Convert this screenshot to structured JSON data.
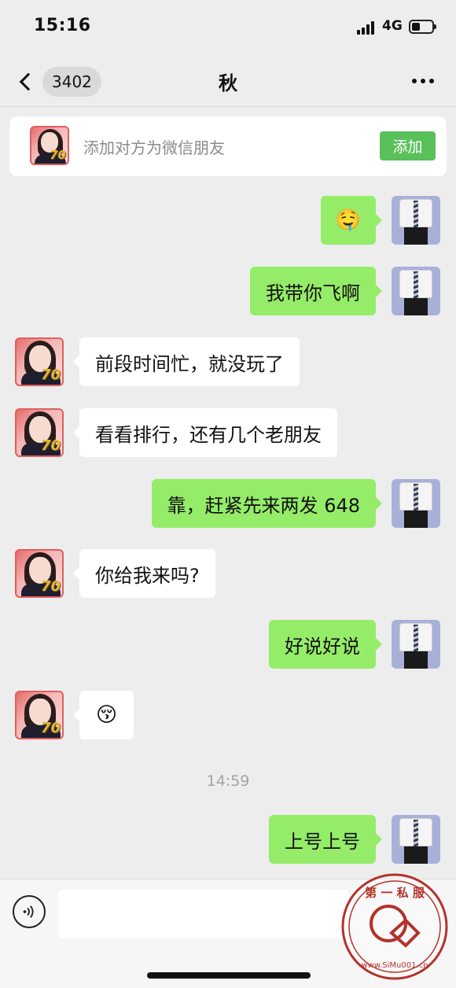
{
  "status_bar": {
    "time": "15:16",
    "network": "4G"
  },
  "nav": {
    "unread_count": "3402",
    "title": "秋"
  },
  "add_friend": {
    "prompt": "添加对方为微信朋友",
    "button_label": "添加"
  },
  "avatar_badge": "70",
  "messages": [
    {
      "side": "out",
      "text": "🤤"
    },
    {
      "side": "out",
      "text": "我带你飞啊"
    },
    {
      "side": "in",
      "text": "前段时间忙，就没玩了"
    },
    {
      "side": "in",
      "text": "看看排行，还有几个老朋友"
    },
    {
      "side": "out",
      "text": "靠，赶紧先来两发 648"
    },
    {
      "side": "in",
      "text": "你给我来吗?"
    },
    {
      "side": "out",
      "text": "好说好说"
    },
    {
      "side": "in",
      "text": "😚"
    },
    {
      "side": "out",
      "text": "上号上号"
    }
  ],
  "timestamp": "14:59",
  "input": {
    "value": "",
    "placeholder": ""
  },
  "watermark": {
    "top_text": "第 一 私 服",
    "bottom_text": "www.SiMu001.cn"
  }
}
